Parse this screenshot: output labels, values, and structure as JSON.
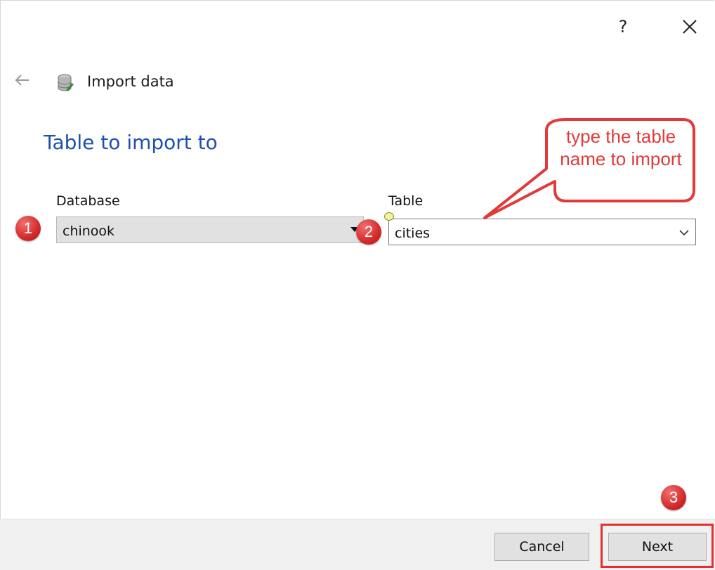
{
  "window": {
    "help_label": "?"
  },
  "header": {
    "title": "Import data"
  },
  "page": {
    "title": "Table to import to"
  },
  "form": {
    "database_label": "Database",
    "database_value": "chinook",
    "table_label": "Table",
    "table_value": "cities"
  },
  "annotations": {
    "callout_text": "type the table name to import",
    "badge_1": "1",
    "badge_2": "2",
    "badge_3": "3",
    "color": "#e23a3a"
  },
  "footer": {
    "cancel_label": "Cancel",
    "next_label": "Next"
  }
}
